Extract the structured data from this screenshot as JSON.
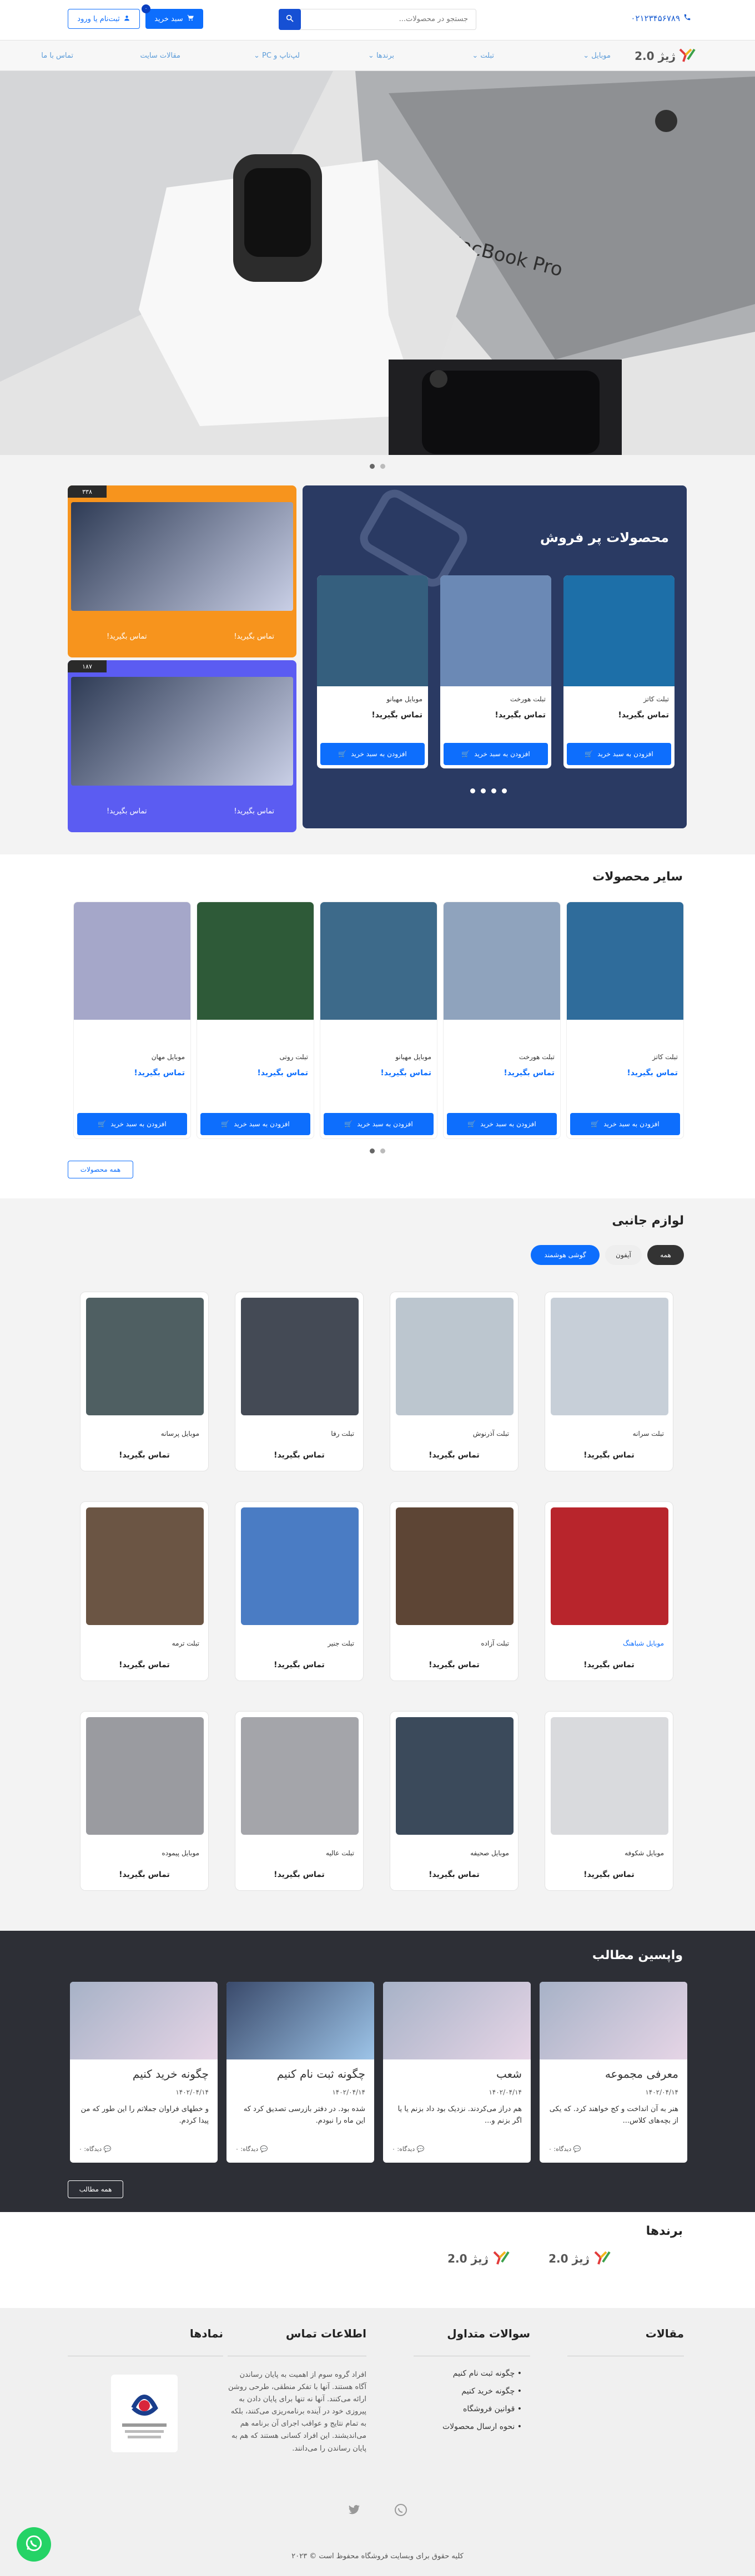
{
  "header": {
    "phone": "۰۲۱۲۳۴۵۶۷۸۹",
    "search_placeholder": "جستجو در محصولات...",
    "cart_label": "سبد خرید",
    "cart_count": "۰",
    "login_label": "ثبت‌نام یا ورود"
  },
  "nav": {
    "logo_text": "ژیژ 2.0",
    "items": [
      "موبایل",
      "تبلت",
      "برندها",
      "لپ‌تاپ و PC",
      "مقالات سایت",
      "تماس با ما"
    ]
  },
  "best_sellers": {
    "title": "محصولات پر فروش",
    "products": [
      {
        "name": "تبلت کاتز",
        "price": "تماس بگیرید!",
        "add": "افزودن به سبد خرید",
        "color": "#1d6fa8"
      },
      {
        "name": "تبلت هورخت",
        "price": "تماس بگیرید!",
        "add": "افزودن به سبد خرید",
        "color": "#6b89b5"
      },
      {
        "name": "موبایل مهبانو",
        "price": "تماس بگیرید!",
        "add": "افزودن به سبد خرید",
        "color": "#355f7e"
      }
    ]
  },
  "banners": [
    {
      "num": "۳۳۸",
      "left": "تماس بگیرید!",
      "right": "تماس بگیرید!",
      "bg": "#f7941d"
    },
    {
      "num": "۱۸۷",
      "left": "تماس بگیرید!",
      "right": "تماس بگیرید!",
      "bg": "#5b5cf2"
    }
  ],
  "other_products": {
    "title": "سایر محصولات",
    "all_label": "همه محصولات",
    "items": [
      {
        "name": "تبلت کاتز",
        "price": "تماس بگیرید!",
        "add": "افزودن به سبد خرید",
        "color": "#2f6c9b"
      },
      {
        "name": "تبلت هورخت",
        "price": "تماس بگیرید!",
        "add": "افزودن به سبد خرید",
        "color": "#8fa3bd"
      },
      {
        "name": "موبایل مهبانو",
        "price": "تماس بگیرید!",
        "add": "افزودن به سبد خرید",
        "color": "#3d6a8a"
      },
      {
        "name": "تبلت روتی",
        "price": "تماس بگیرید!",
        "add": "افزودن به سبد خرید",
        "color": "#2e5a38"
      },
      {
        "name": "موبایل مهان",
        "price": "تماس بگیرید!",
        "add": "افزودن به سبد خرید",
        "color": "#a5a7c9"
      }
    ]
  },
  "accessories": {
    "title": "لوازم جانبی",
    "tabs": [
      "همه",
      "آیفون",
      "گوشی هوشمند"
    ],
    "items": [
      {
        "name": "تبلت سرانه",
        "price": "تماس بگیرید!",
        "color": "#c7cfd8"
      },
      {
        "name": "تبلت آذرنوش",
        "price": "تماس بگیرید!",
        "color": "#bcc6cf"
      },
      {
        "name": "تبلت رفا",
        "price": "تماس بگیرید!",
        "color": "#444a55"
      },
      {
        "name": "موبایل پرسانه",
        "price": "تماس بگیرید!",
        "color": "#4f5f62"
      },
      {
        "name": "موبایل شباهنگ",
        "price": "تماس بگیرید!",
        "color": "#b8252c"
      },
      {
        "name": "تبلت آزاده",
        "price": "تماس بگیرید!",
        "color": "#5d4535"
      },
      {
        "name": "تبلت جنیر",
        "price": "تماس بگیرید!",
        "color": "#4a7cc4"
      },
      {
        "name": "تبلت ترمه",
        "price": "تماس بگیرید!",
        "color": "#6b5544"
      },
      {
        "name": "موبایل شکوفه",
        "price": "تماس بگیرید!",
        "color": "#d9dadd"
      },
      {
        "name": "موبایل صحیفه",
        "price": "تماس بگیرید!",
        "color": "#3b4a5b"
      },
      {
        "name": "تبلت عالیه",
        "price": "تماس بگیرید!",
        "color": "#a4a5aa"
      },
      {
        "name": "موبایل پیموده",
        "price": "تماس بگیرید!",
        "color": "#9a9ba0"
      }
    ]
  },
  "posts": {
    "title": "واپسین مطالب",
    "all_label": "همه مطالب",
    "items": [
      {
        "title": "معرفی مجموعه",
        "date": "۱۴۰۲/۰۴/۱۴",
        "excerpt": "هنر به آن انداخت و کج خواهند کرد. که یکی از بچه‌های کلاس...",
        "comments": "دیدگاه: ۰"
      },
      {
        "title": "شعب",
        "date": "۱۴۰۲/۰۴/۱۴",
        "excerpt": "هم دراز می‌کردند. نزدیک بود داد بزنم یا یا اگر بزنم و...",
        "comments": "دیدگاه: ۰"
      },
      {
        "title": "چگونه ثبت نام کنیم",
        "date": "۱۴۰۲/۰۴/۱۴",
        "excerpt": "شده بود. در دفتر بازرسی تصدیق کرد که این ماه را نبودم.",
        "comments": "دیدگاه: ۰"
      },
      {
        "title": "چگونه خرید کنیم",
        "date": "۱۴۰۲/۰۴/۱۴",
        "excerpt": "و خطهای فراوان جملاتم را این طور که من پیدا کردم.",
        "comments": "دیدگاه: ۰"
      }
    ]
  },
  "brands": {
    "title": "برندها",
    "items": [
      "ژیژ 2.0",
      "ژیژ 2.0"
    ]
  },
  "footer": {
    "articles_title": "مقالات",
    "faq_title": "سوالات متداول",
    "faq_items": [
      "چگونه ثبت نام کنیم",
      "چگونه خرید کنیم",
      "قوانین فروشگاه",
      "نحوه ارسال محصولات"
    ],
    "contact_title": "اطلاعات تماس",
    "contact_text": "افراد گروه سوم از اهمیت به پایان رساندن آگاه هستند. آنها با تفکر منطقی، طرحی روشن ارائه می‌کنند. آنها نه تنها برای پایان دادن به پیروزی خود در آینده برنامه‌ریزی می‌کنند، بلکه به تمام نتایج و عواقب اجرای آن برنامه هم می‌اندیشند. این افراد کسانی هستند که هم به پایان رساندن را می‌دانند.",
    "badges_title": "نمادها",
    "copyright": "کلیه حقوق برای وبسایت فروشگاه محفوظ است © ۲۰۲۳"
  },
  "colors": {
    "primary": "#0d6efd",
    "navy": "#2a3a63",
    "dark": "#2d2f36",
    "orange": "#f7941d",
    "violet": "#5b5cf2"
  }
}
